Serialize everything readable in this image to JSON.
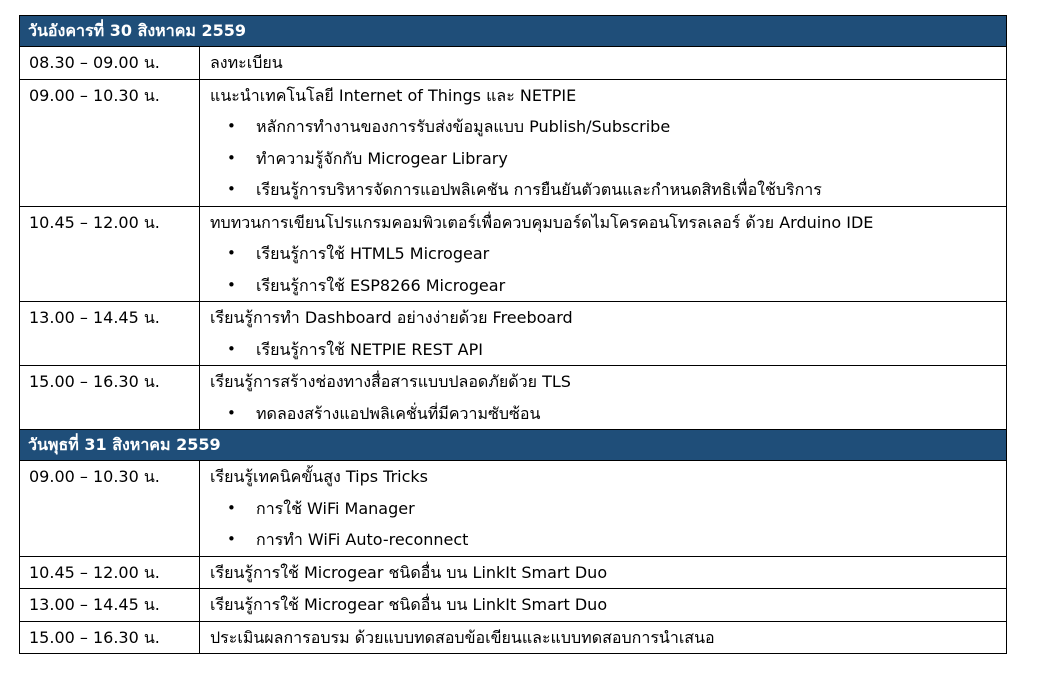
{
  "days": [
    {
      "title": "วันอังคารที่ 30 สิงหาคม 2559",
      "sessions": [
        {
          "time": "08.30 – 09.00 น.",
          "title": "ลงทะเบียน",
          "bullets": []
        },
        {
          "time": "09.00 – 10.30 น.",
          "title": "แนะนำเทคโนโลยี Internet of Things และ NETPIE",
          "bullets": [
            "หลักการทำงานของการรับส่งข้อมูลแบบ Publish/Subscribe",
            "ทำความรู้จักกับ Microgear Library",
            "เรียนรู้การบริหารจัดการแอปพลิเคชัน การยืนยันตัวตนและกำหนดสิทธิเพื่อใช้บริการ"
          ]
        },
        {
          "time": "10.45 – 12.00 น.",
          "title": "ทบทวนการเขียนโปรแกรมคอมพิวเตอร์เพื่อควบคุมบอร์ดไมโครคอนโทรลเลอร์ ด้วย Arduino IDE",
          "bullets": [
            "เรียนรู้การใช้ HTML5 Microgear",
            "เรียนรู้การใช้ ESP8266 Microgear"
          ]
        },
        {
          "time": "13.00 – 14.45 น.",
          "title": "เรียนรู้การทำ Dashboard อย่างง่ายด้วย Freeboard",
          "bullets": [
            "เรียนรู้การใช้ NETPIE REST API"
          ]
        },
        {
          "time": "15.00 – 16.30 น.",
          "title": "เรียนรู้การสร้างช่องทางสื่อสารแบบปลอดภัยด้วย TLS",
          "bullets": [
            "ทดลองสร้างแอปพลิเคชั่นที่มีความซับซ้อน"
          ]
        }
      ]
    },
    {
      "title": "วันพุธที่ 31 สิงหาคม 2559",
      "sessions": [
        {
          "time": "09.00 – 10.30 น.",
          "title": "เรียนรู้เทคนิคขั้นสูง Tips Tricks",
          "bullets": [
            "การใช้ WiFi Manager",
            "การทำ WiFi Auto-reconnect"
          ]
        },
        {
          "time": "10.45 – 12.00 น.",
          "title": "เรียนรู้การใช้ Microgear ชนิดอื่น บน LinkIt Smart Duo",
          "bullets": []
        },
        {
          "time": "13.00 – 14.45 น.",
          "title": "เรียนรู้การใช้ Microgear ชนิดอื่น บน LinkIt Smart Duo",
          "bullets": []
        },
        {
          "time": "15.00 – 16.30 น.",
          "title": "ประเมินผลการอบรม ด้วยแบบทดสอบข้อเขียนและแบบทดสอบการนำเสนอ",
          "bullets": []
        }
      ]
    }
  ]
}
